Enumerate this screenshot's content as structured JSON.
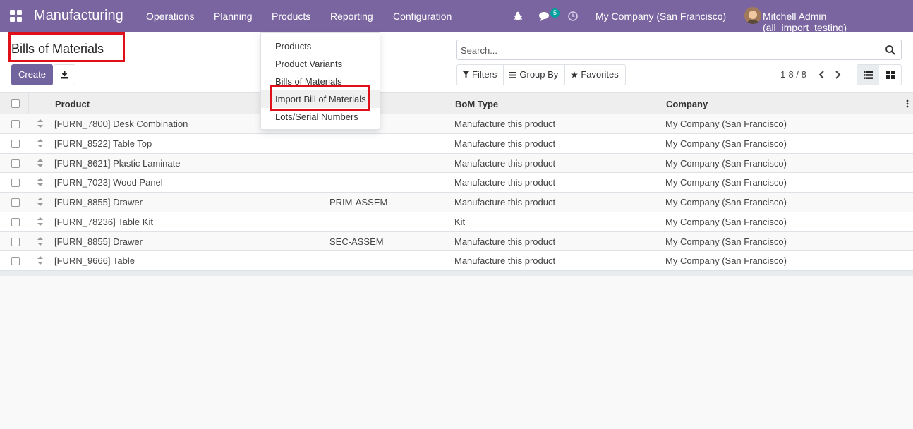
{
  "navbar": {
    "app_name": "Manufacturing",
    "menus": [
      "Operations",
      "Planning",
      "Products",
      "Reporting",
      "Configuration"
    ],
    "chat_badge": "5",
    "company": "My Company (San Francisco)",
    "user": "Mitchell Admin (all_import_testing)",
    "color": "#7a65a0"
  },
  "control_panel": {
    "title": "Bills of Materials",
    "create_label": "Create",
    "search_placeholder": "Search...",
    "filters_label": "Filters",
    "group_by_label": "Group By",
    "favorites_label": "Favorites",
    "pager": "1-8 / 8",
    "accent": "#71639e"
  },
  "products_menu": {
    "items": [
      "Products",
      "Product Variants",
      "Bills of Materials",
      "Import Bill of Materials",
      "Lots/Serial Numbers"
    ],
    "highlighted": "Import Bill of Materials"
  },
  "table": {
    "headers": [
      "Product",
      "BoM Type",
      "Company"
    ],
    "rows": [
      {
        "product": "[FURN_7800] Desk Combination",
        "reference": "",
        "bom_type": "Manufacture this product",
        "company": "My Company (San Francisco)"
      },
      {
        "product": "[FURN_8522] Table Top",
        "reference": "",
        "bom_type": "Manufacture this product",
        "company": "My Company (San Francisco)"
      },
      {
        "product": "[FURN_8621] Plastic Laminate",
        "reference": "",
        "bom_type": "Manufacture this product",
        "company": "My Company (San Francisco)"
      },
      {
        "product": "[FURN_7023] Wood Panel",
        "reference": "",
        "bom_type": "Manufacture this product",
        "company": "My Company (San Francisco)"
      },
      {
        "product": "[FURN_8855] Drawer",
        "reference": "PRIM-ASSEM",
        "bom_type": "Manufacture this product",
        "company": "My Company (San Francisco)"
      },
      {
        "product": "[FURN_78236] Table Kit",
        "reference": "",
        "bom_type": "Kit",
        "company": "My Company (San Francisco)"
      },
      {
        "product": "[FURN_8855] Drawer",
        "reference": "SEC-ASSEM",
        "bom_type": "Manufacture this product",
        "company": "My Company (San Francisco)"
      },
      {
        "product": "[FURN_9666] Table",
        "reference": "",
        "bom_type": "Manufacture this product",
        "company": "My Company (San Francisco)"
      }
    ]
  },
  "highlight_color": "#e0101a"
}
